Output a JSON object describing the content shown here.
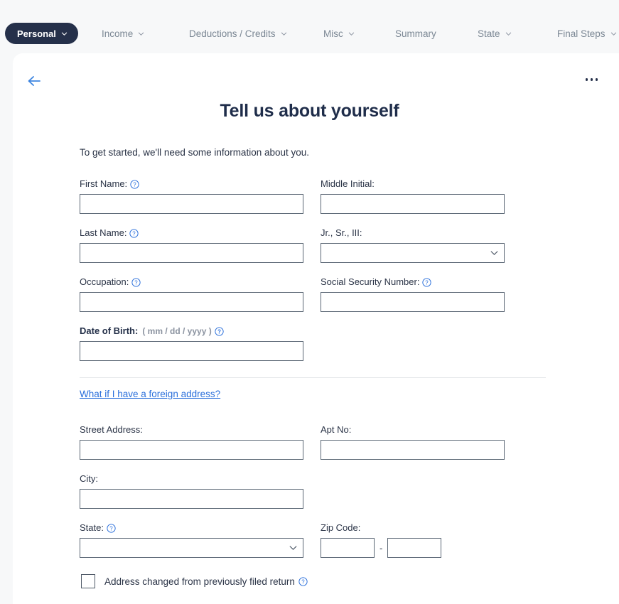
{
  "nav": {
    "active_item": {
      "label": "Personal",
      "icon": "chevron-down-icon"
    },
    "items": [
      {
        "label": "Income",
        "has_chevron": true
      },
      {
        "label": "Deductions / Credits",
        "has_chevron": true
      },
      {
        "label": "Misc",
        "has_chevron": true
      },
      {
        "label": "Summary",
        "has_chevron": false
      },
      {
        "label": "State",
        "has_chevron": true
      },
      {
        "label": "Final Steps",
        "has_chevron": true
      }
    ]
  },
  "header": {
    "back_icon": "arrow-left-icon",
    "more_icon": "ellipsis-icon",
    "title": "Tell us about yourself",
    "intro": "To get started, we'll need some information about you."
  },
  "colors": {
    "nav_active_bg": "#25304a",
    "nav_text": "#7b8794",
    "title": "#1f2d4a",
    "link": "#2a6fdb",
    "help_icon": "#2a6fdb",
    "input_border": "#5a6674",
    "card_bg": "#ffffff",
    "page_bg": "#f7f8f9"
  },
  "form": {
    "first_name": {
      "label": "First Name:",
      "value": "",
      "help": true
    },
    "middle_initial": {
      "label": "Middle Initial:",
      "value": "",
      "help": false
    },
    "last_name": {
      "label": "Last Name:",
      "value": "",
      "help": true
    },
    "suffix": {
      "label": "Jr., Sr., III:",
      "value": "",
      "help": false,
      "type": "select"
    },
    "occupation": {
      "label": "Occupation:",
      "value": "",
      "help": true
    },
    "ssn": {
      "label": "Social Security Number:",
      "value": "",
      "help": true
    },
    "dob": {
      "label": "Date of Birth:",
      "hint": "( mm / dd / yyyy )",
      "value": "",
      "help": true
    },
    "foreign_address_link": "What if I have a foreign address?",
    "street_address": {
      "label": "Street Address:",
      "value": "",
      "help": false
    },
    "apt_no": {
      "label": "Apt No:",
      "value": "",
      "help": false
    },
    "city": {
      "label": "City:",
      "value": "",
      "help": false
    },
    "state": {
      "label": "State:",
      "value": "",
      "help": true,
      "type": "select"
    },
    "zip": {
      "label": "Zip Code:",
      "value_first": "",
      "value_last": "",
      "separator": "-"
    },
    "address_changed": {
      "label": "Address changed from previously filed return",
      "checked": false,
      "help": true
    }
  }
}
